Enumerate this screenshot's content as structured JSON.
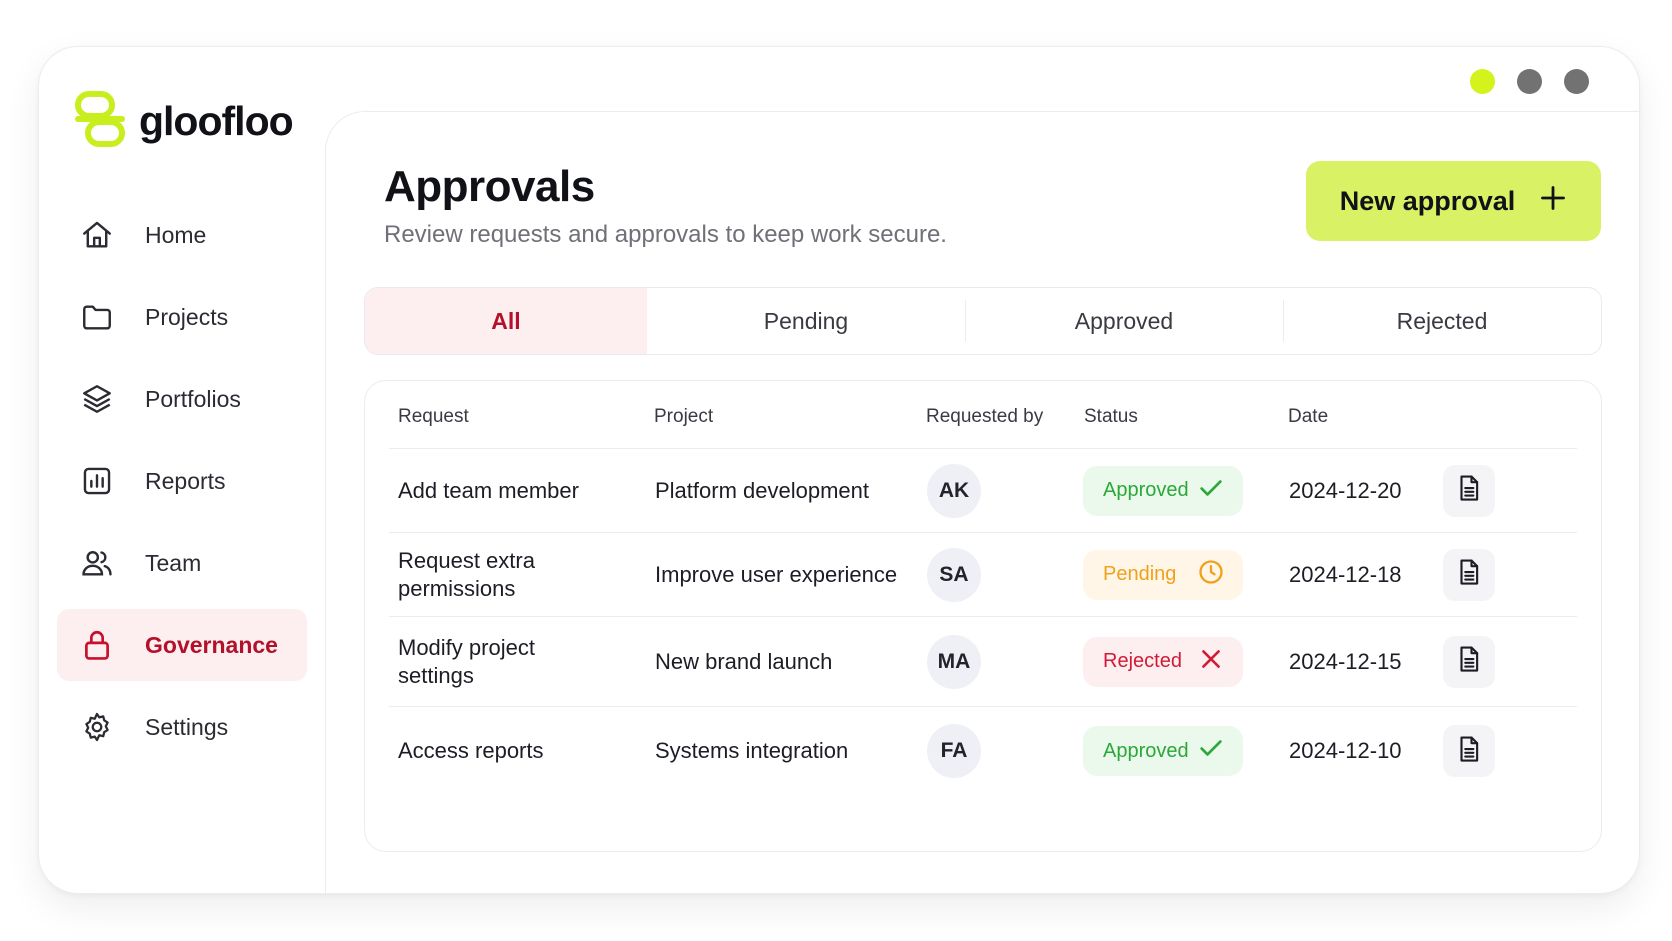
{
  "app": {
    "brand": "gloofloo",
    "colors": {
      "accent": "#d9f165",
      "brand_lime": "#c8ee1e",
      "active": "#b3102a",
      "active_bg": "#fdeef0"
    },
    "window_dots": [
      "lime-dot",
      "gray-dot",
      "gray-dot"
    ]
  },
  "sidebar": {
    "items": [
      {
        "label": "Home",
        "icon": "home-icon"
      },
      {
        "label": "Projects",
        "icon": "folder-icon"
      },
      {
        "label": "Portfolios",
        "icon": "layers-icon"
      },
      {
        "label": "Reports",
        "icon": "chart-icon"
      },
      {
        "label": "Team",
        "icon": "users-icon"
      },
      {
        "label": "Governance",
        "icon": "lock-icon",
        "active": true
      },
      {
        "label": "Settings",
        "icon": "gear-icon"
      }
    ]
  },
  "header": {
    "title": "Approvals",
    "subtitle": "Review requests and approvals to keep work secure.",
    "new_button_label": "New approval"
  },
  "tabs": [
    {
      "label": "All",
      "active": true
    },
    {
      "label": "Pending"
    },
    {
      "label": "Approved"
    },
    {
      "label": "Rejected"
    }
  ],
  "table": {
    "columns": [
      "Request",
      "Project",
      "Requested by",
      "Status",
      "Date"
    ],
    "rows": [
      {
        "request": "Add team member",
        "project": "Platform development",
        "initials": "AK",
        "status": "Approved",
        "status_kind": "approved",
        "date": "2024-12-20"
      },
      {
        "request": "Request extra permissions",
        "project": "Improve user experience",
        "initials": "SA",
        "status": "Pending",
        "status_kind": "pending",
        "date": "2024-12-18"
      },
      {
        "request": "Modify project settings",
        "project": "New brand launch",
        "initials": "MA",
        "status": "Rejected",
        "status_kind": "rejected",
        "date": "2024-12-15"
      },
      {
        "request": "Access reports",
        "project": "Systems integration",
        "initials": "FA",
        "status": "Approved",
        "status_kind": "approved",
        "date": "2024-12-10"
      }
    ]
  }
}
